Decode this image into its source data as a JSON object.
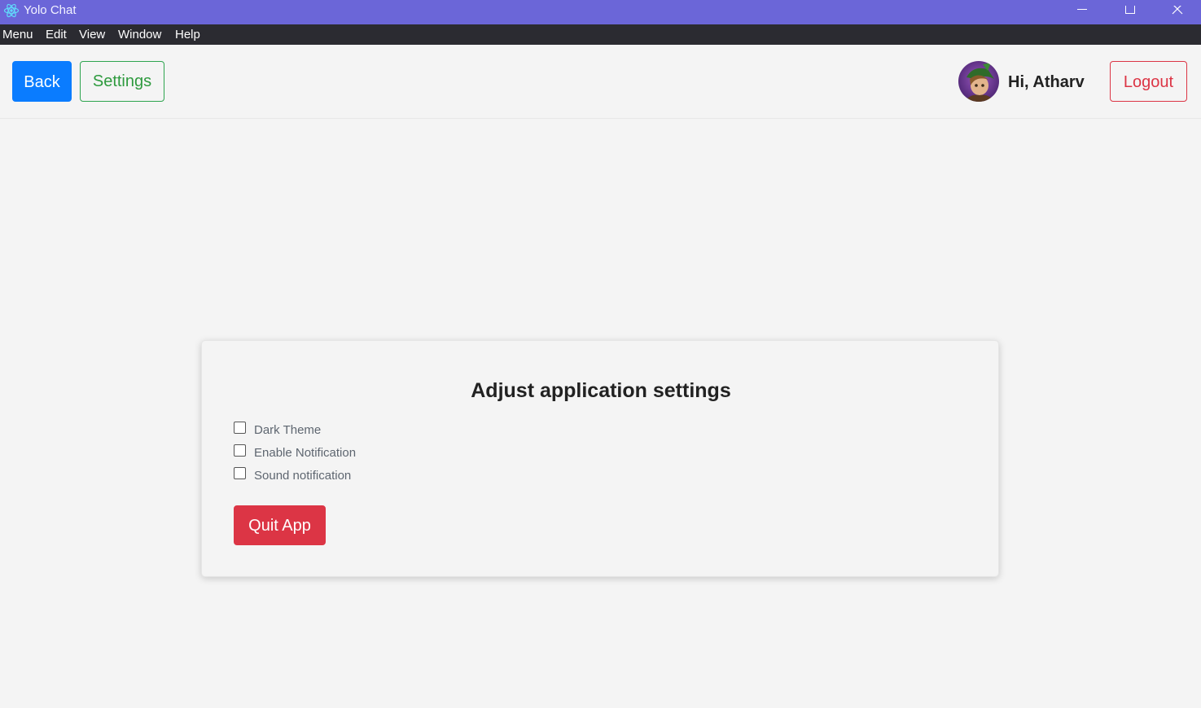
{
  "window": {
    "title": "Yolo Chat",
    "titlebar_color": "#6b66d8"
  },
  "menubar": {
    "items": [
      {
        "label": "Menu"
      },
      {
        "label": "Edit"
      },
      {
        "label": "View"
      },
      {
        "label": "Window"
      },
      {
        "label": "Help"
      }
    ]
  },
  "header": {
    "back_label": "Back",
    "settings_label": "Settings",
    "greeting": "Hi, Atharv",
    "logout_label": "Logout"
  },
  "settings": {
    "title": "Adjust application settings",
    "options": [
      {
        "label": "Dark Theme",
        "checked": false
      },
      {
        "label": "Enable Notification",
        "checked": false
      },
      {
        "label": "Sound notification",
        "checked": false
      }
    ],
    "quit_label": "Quit App"
  },
  "colors": {
    "primary": "#0a7cff",
    "success": "#2ea44f",
    "danger": "#dc3545",
    "menubar": "#2b2b31",
    "background": "#f4f4f4"
  },
  "icons": {
    "app": "react-atom-icon",
    "minimize": "minimize-icon",
    "maximize": "maximize-icon",
    "close": "close-icon"
  }
}
